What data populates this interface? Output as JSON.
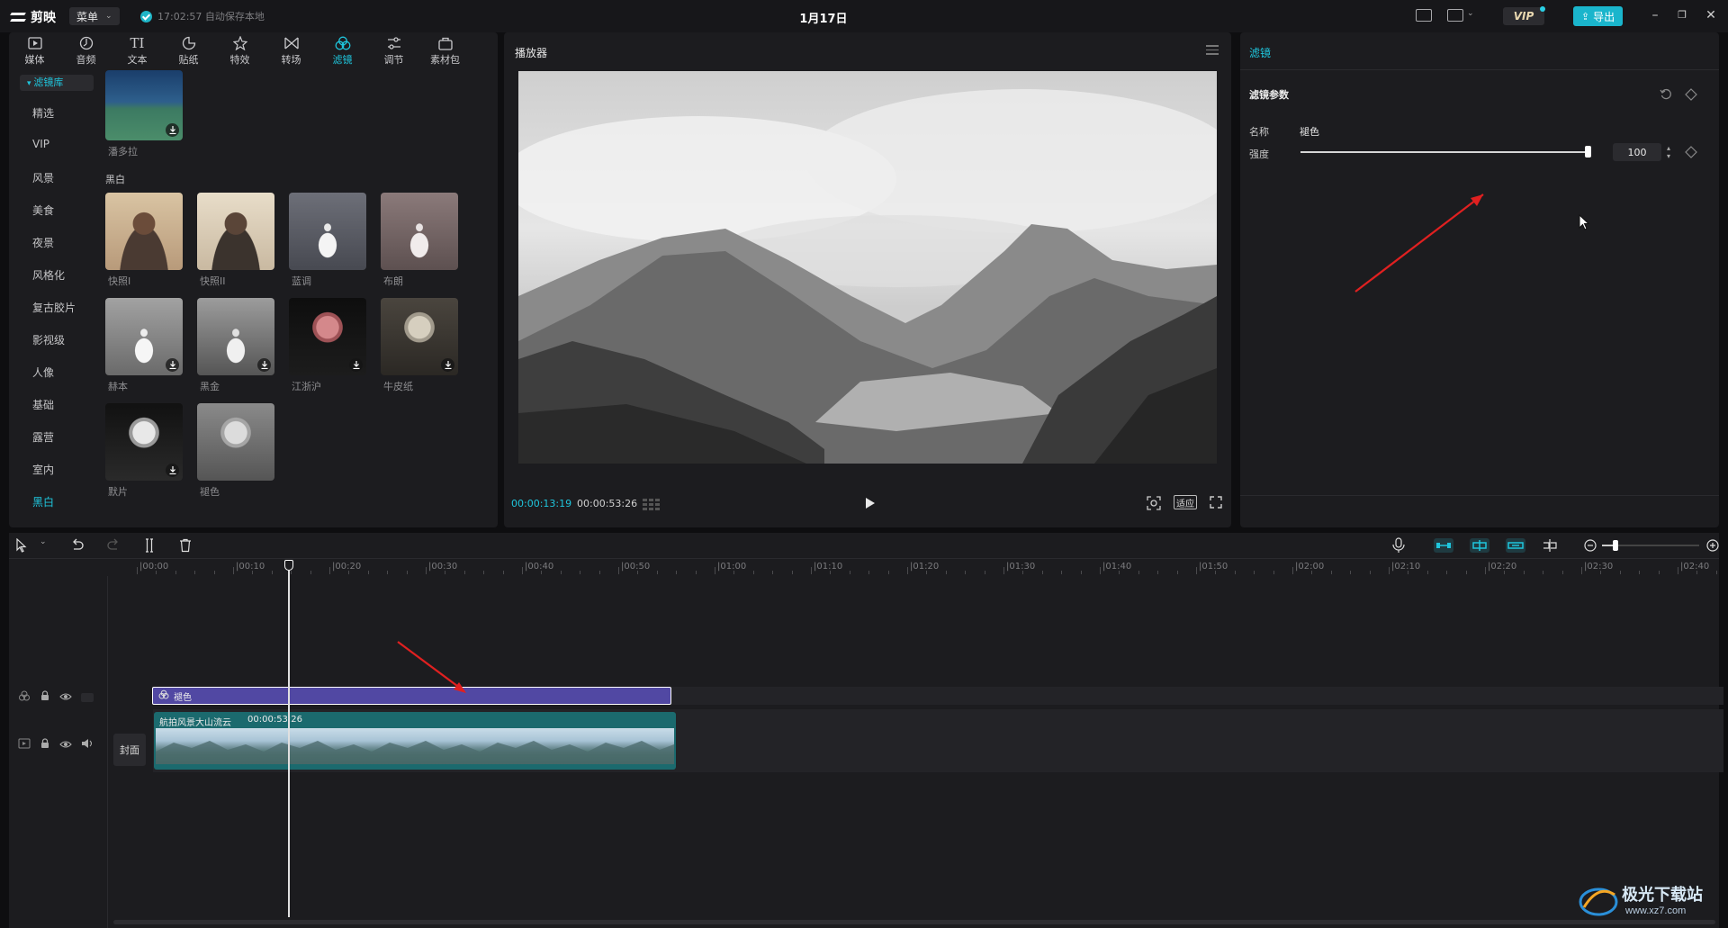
{
  "app": {
    "name": "剪映",
    "menu_label": "菜单",
    "autosave": "17:02:57 自动保存本地",
    "title": "1月17日",
    "vip": "VIP",
    "export_label": "导出"
  },
  "toolbar": [
    {
      "label": "媒体",
      "icon": "media-icon"
    },
    {
      "label": "音频",
      "icon": "audio-icon"
    },
    {
      "label": "文本",
      "icon": "text-icon"
    },
    {
      "label": "贴纸",
      "icon": "sticker-icon"
    },
    {
      "label": "特效",
      "icon": "effects-icon"
    },
    {
      "label": "转场",
      "icon": "transition-icon"
    },
    {
      "label": "滤镜",
      "icon": "filter-icon",
      "active": true
    },
    {
      "label": "调节",
      "icon": "adjust-icon"
    },
    {
      "label": "素材包",
      "icon": "material-pack-icon"
    }
  ],
  "categories": {
    "library": "滤镜库",
    "items": [
      "精选",
      "VIP",
      "风景",
      "美食",
      "夜景",
      "风格化",
      "复古胶片",
      "影视级",
      "人像",
      "基础",
      "露营",
      "室内",
      "黑白"
    ],
    "active": "黑白"
  },
  "filters": {
    "prev_item": "潘多拉",
    "section": "黑白",
    "items": [
      "快照I",
      "快照II",
      "蓝调",
      "布朗",
      "赫本",
      "黑金",
      "江浙沪",
      "牛皮纸",
      "默片",
      "褪色"
    ]
  },
  "player": {
    "title": "播放器",
    "current_time": "00:00:13:19",
    "total_time": "00:00:53:26",
    "ratio_label": "适应"
  },
  "inspector": {
    "tab": "滤镜",
    "section": "滤镜参数",
    "name_label": "名称",
    "name_value": "褪色",
    "intensity_label": "强度",
    "intensity_value": "100",
    "intensity": 100
  },
  "timeline": {
    "ticks": [
      "00:00",
      "00:10",
      "00:20",
      "00:30",
      "00:40",
      "00:50",
      "01:00",
      "01:10",
      "01:20",
      "01:30",
      "01:40",
      "01:50",
      "02:00",
      "02:10",
      "02:20",
      "02:30",
      "02:40"
    ],
    "filter_clip": "褪色",
    "video_clip_name": "航拍风景大山流云",
    "video_clip_duration": "00:00:53:26",
    "cover_label": "封面"
  },
  "watermark": {
    "text": "极光下载站",
    "url": "www.xz7.com"
  },
  "colors": {
    "accent": "#1fc6dd",
    "filter_clip": "#5148a3",
    "video_clip": "#1b6a6e",
    "annotation_arrow": "#e02020"
  }
}
